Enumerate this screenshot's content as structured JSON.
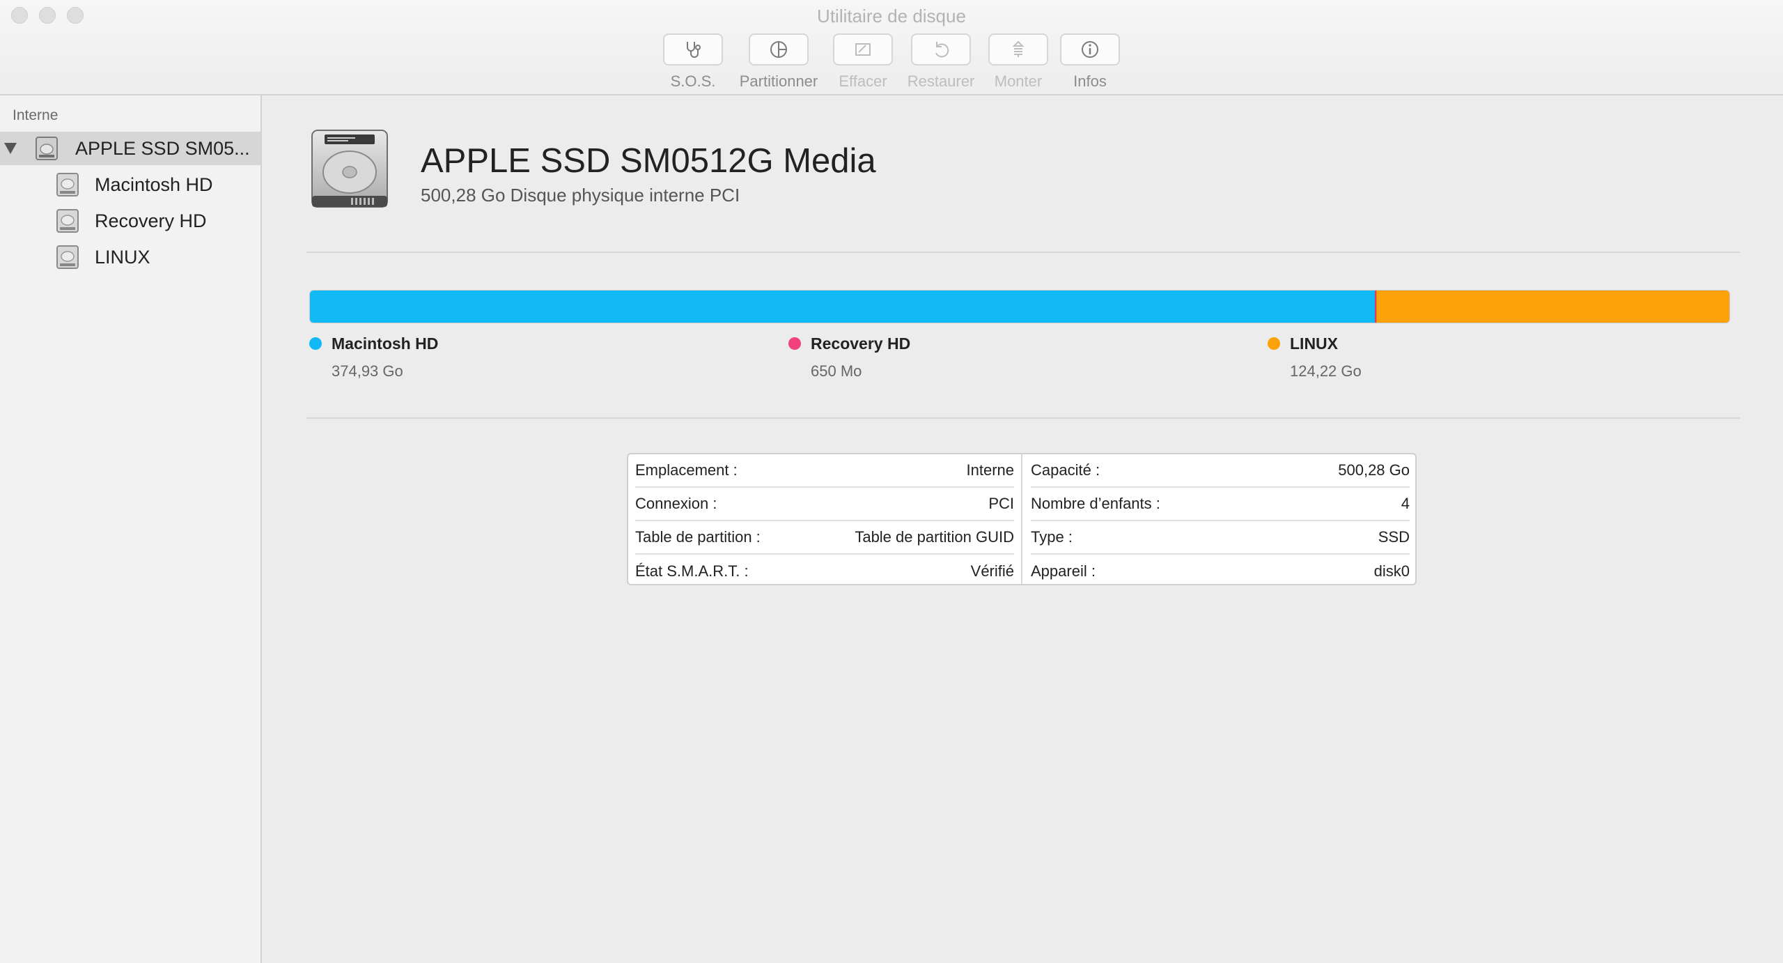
{
  "window": {
    "title": "Utilitaire de disque"
  },
  "toolbar": {
    "items": [
      {
        "label": "S.O.S.",
        "icon": "stethoscope-icon",
        "enabled": true
      },
      {
        "label": "Partitionner",
        "icon": "partition-pie-icon",
        "enabled": true
      },
      {
        "label": "Effacer",
        "icon": "erase-icon",
        "enabled": false
      },
      {
        "label": "Restaurer",
        "icon": "restore-arrow-icon",
        "enabled": false
      },
      {
        "label": "Monter",
        "icon": "mount-icon",
        "enabled": false
      },
      {
        "label": "Infos",
        "icon": "info-icon",
        "enabled": true
      }
    ]
  },
  "sidebar": {
    "section": "Interne",
    "items": [
      {
        "label": "APPLE SSD SM05...",
        "icon": "disk-icon",
        "selected": true,
        "level": 0
      },
      {
        "label": "Macintosh HD",
        "icon": "volume-icon",
        "selected": false,
        "level": 1
      },
      {
        "label": "Recovery HD",
        "icon": "volume-icon",
        "selected": false,
        "level": 1
      },
      {
        "label": "LINUX",
        "icon": "volume-icon",
        "selected": false,
        "level": 1
      }
    ]
  },
  "disk": {
    "title": "APPLE SSD SM0512G Media",
    "subtitle": "500,28 Go Disque physique interne PCI",
    "icon": "internal-drive-icon"
  },
  "partitions": [
    {
      "name": "Macintosh HD",
      "size": "374,93 Go",
      "gb": 374.93,
      "color": "#12b9f7"
    },
    {
      "name": "Recovery HD",
      "size": "650 Mo",
      "gb": 0.65,
      "color": "#f0417a"
    },
    {
      "name": "LINUX",
      "size": "124,22 Go",
      "gb": 124.22,
      "color": "#fca10a"
    }
  ],
  "info": {
    "left": [
      {
        "label": "Emplacement :",
        "value": "Interne"
      },
      {
        "label": "Connexion :",
        "value": "PCI"
      },
      {
        "label": "Table de partition :",
        "value": "Table de partition GUID"
      },
      {
        "label": "État S.M.A.R.T. :",
        "value": "Vérifié"
      }
    ],
    "right": [
      {
        "label": "Capacité :",
        "value": "500,28 Go"
      },
      {
        "label": "Nombre d’enfants :",
        "value": "4"
      },
      {
        "label": "Type :",
        "value": "SSD"
      },
      {
        "label": "Appareil :",
        "value": "disk0"
      }
    ]
  }
}
